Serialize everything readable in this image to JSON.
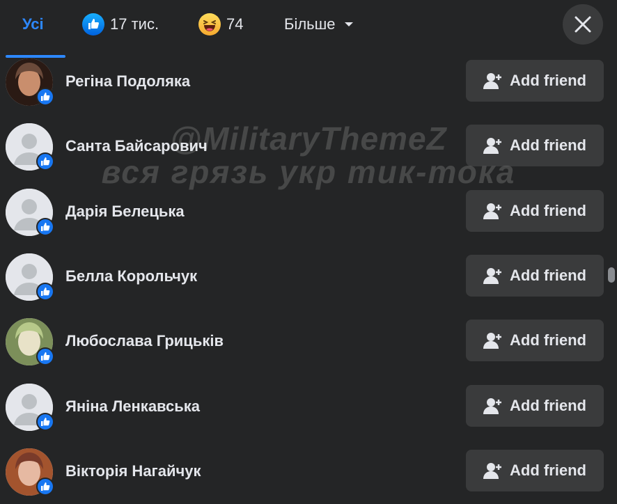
{
  "tabs": {
    "all_label": "Усі",
    "like_count": "17 тис.",
    "haha_count": "74",
    "more_label": "Більше"
  },
  "colors": {
    "background": "#242526",
    "button": "#3a3b3c",
    "accent": "#2d88ff",
    "text": "#e4e6eb"
  },
  "icons": {
    "like": "like-reaction-icon",
    "haha": "haha-reaction-icon",
    "close": "close-icon",
    "add_friend": "add-friend-icon"
  },
  "watermark": {
    "line1": "@MilitaryThemeZ",
    "line2": "вся грязь укр тик-тока"
  },
  "people": [
    {
      "name": "Регіна Подоляка",
      "button": "Add friend",
      "avatar": "photo"
    },
    {
      "name": "Санта Байсарович",
      "button": "Add friend",
      "avatar": "default"
    },
    {
      "name": "Дарія Белецька",
      "button": "Add friend",
      "avatar": "default"
    },
    {
      "name": "Белла Корольчук",
      "button": "Add friend",
      "avatar": "default"
    },
    {
      "name": "Любослава Грицьків",
      "button": "Add friend",
      "avatar": "photo"
    },
    {
      "name": "Яніна Ленкавська",
      "button": "Add friend",
      "avatar": "default"
    },
    {
      "name": "Вікторія Нагайчук",
      "button": "Add friend",
      "avatar": "photo"
    }
  ]
}
